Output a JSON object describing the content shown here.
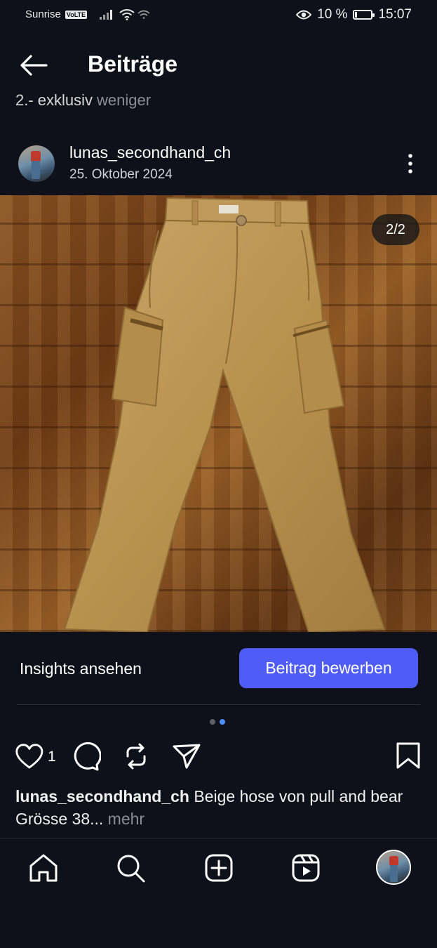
{
  "status_bar": {
    "carrier": "Sunrise",
    "volte": "VoLTE",
    "battery": "10 %",
    "time": "15:07"
  },
  "header": {
    "title": "Beiträge",
    "back_icon": "arrow-left-icon"
  },
  "previous_post_peek": {
    "text": "2.- exklusiv",
    "less_label": "weniger"
  },
  "post": {
    "username": "lunas_secondhand_ch",
    "date": "25. Oktober 2024",
    "more_icon": "more-vertical-icon",
    "image_counter": "2/2",
    "image_description": "beige cargo pants on wooden floor",
    "carousel": {
      "total": 2,
      "active": 2
    },
    "insights_label": "Insights ansehen",
    "promote_label": "Beitrag bewerben",
    "like_count": "1",
    "caption": {
      "username": "lunas_secondhand_ch",
      "line1": "Beige hose von pull and bear",
      "line2": "Grösse 38...",
      "more_label": "mehr"
    }
  },
  "bottom_nav": [
    "home-icon",
    "search-icon",
    "create-icon",
    "reels-icon",
    "profile-avatar"
  ],
  "colors": {
    "background": "#0e111a",
    "promote_button": "#4f5cf5",
    "active_dot": "#4f8ff7"
  }
}
